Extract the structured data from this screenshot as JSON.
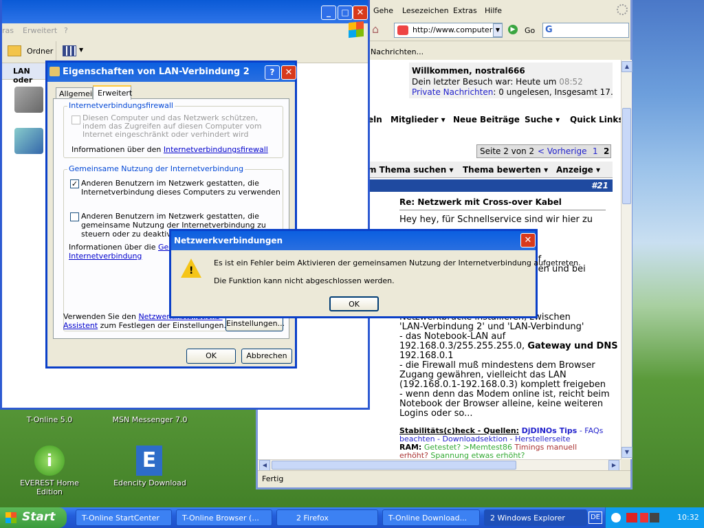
{
  "browser": {
    "menu": [
      "Gehe",
      "Lesezeichen",
      "Extras",
      "Hilfe"
    ],
    "url": "http://www.computerba",
    "go_label": "Go",
    "nav_text": "Nachrichten...",
    "welcome_title": "Willkommen, nostral666",
    "welcome_last_visit_prefix": "Dein letzter Besuch war: Heute um ",
    "welcome_last_visit_time": "08:52",
    "pm_link": "Private Nachrichten",
    "pm_text": ": 0 ungelesen, Insgesamt 17.",
    "forum_nav": [
      "eln",
      "Mitglieder",
      "Neue Beiträge",
      "Suche",
      "Quick Links"
    ],
    "pager": {
      "text": "Seite 2 von 2",
      "prev": "< Vorherige",
      "page1": "1",
      "page2": "2"
    },
    "thread_tools": [
      "m Thema suchen",
      "Thema bewerten",
      "Anzeige"
    ],
    "post_number": "#21",
    "post_title": "Re: Netzwerk mit Cross-over Kabel",
    "post_lines": [
      "Hey hey, für Schnellservice sind wir hier zu",
      "if",
      "len und bei",
      "Netzwerkbrücke installieren, zwischen",
      "'LAN-Verbindung 2' und 'LAN-Verbindung'",
      "- das Notebook-LAN auf",
      "192.168.0.3/255.255.255.0,",
      "Gateway und DNS",
      "192.168.0.1",
      "- die Firewall muß mindestens dem Browser",
      "Zugang gewähren, vielleicht das LAN",
      "(192.168.0.1-192.168.0.3) komplett freigeben",
      "- wenn denn das Modem online ist, reicht beim",
      "Notebook der Browser alleine, keine weiteren",
      "Logins oder so..."
    ],
    "sig": {
      "l1a": "Stabilitäts(c)heck - Quellen:",
      "l1b": "DjDINOs Tips",
      "l1c": "- FAQs",
      "l2": "beachten - Downloadsektion - Herstellerseite",
      "l3a": "RAM:",
      "l3b": "Getestet? >Memtest86",
      "l3c": "Timings manuell",
      "l4a": "erhöht?",
      "l4b": "Spannung etwas erhöht?"
    },
    "status": "Fertig"
  },
  "explorer": {
    "menu": [
      "ras",
      "Erweitert",
      "?"
    ],
    "folder_btn": "Ordner",
    "lan_label": "LAN oder"
  },
  "props": {
    "title": "Eigenschaften von LAN-Verbindung 2",
    "tab_general": "Allgemein",
    "tab_advanced": "Erweitert",
    "fw_group": "Internetverbindungsfirewall",
    "fw_check": "Diesen Computer und das Netzwerk schützen, indem das Zugreifen auf diesen Computer vom Internet eingeschränkt oder verhindert wird",
    "fw_info_prefix": "Informationen über den ",
    "fw_info_link": "Internetverbindungsfirewall",
    "ics_group": "Gemeinsame Nutzung der Internetverbindung",
    "ics_check1": "Anderen Benutzern im Netzwerk gestatten, die Internetverbindung dieses Computers zu verwenden",
    "ics_check2": "Anderen Benutzern im Netzwerk gestatten, die gemeinsame Nutzung der Internetverbindung zu steuern oder zu deaktivieren",
    "ics_info_prefix": "Informationen über die ",
    "ics_info_link1": "Gemeins",
    "ics_info_link2": "Internetverbindung",
    "wizard_prefix": "Verwenden Sie den ",
    "wizard_link1": "Netzwerkinstallations-",
    "wizard_link2": "Assistent",
    "wizard_suffix": " zum Festlegen der Einstellungen.",
    "settings_btn": "Einstellungen...",
    "ok_btn": "OK",
    "cancel_btn": "Abbrechen"
  },
  "error": {
    "title": "Netzwerkverbindungen",
    "line1": "Es ist ein Fehler beim Aktivieren der gemeinsamen Nutzung der Internetverbindung aufgetreten.",
    "line2": "Die Funktion kann nicht abgeschlossen werden.",
    "ok": "OK"
  },
  "desktop": {
    "icons": [
      "T-Online 5.0",
      "MSN Messenger 7.0",
      "EVEREST Home Edition",
      "Edencity Download"
    ]
  },
  "taskbar": {
    "start": "Start",
    "tasks": [
      "T-Online StartCenter",
      "T-Online Browser (...",
      "2 Firefox",
      "T-Online Download...",
      "2 Windows Explorer"
    ],
    "lang": "DE",
    "clock": "10:32"
  },
  "colors": {
    "accent": "#0a3fc8",
    "link": "#0000cc",
    "start_green": "#3a9a3c"
  }
}
